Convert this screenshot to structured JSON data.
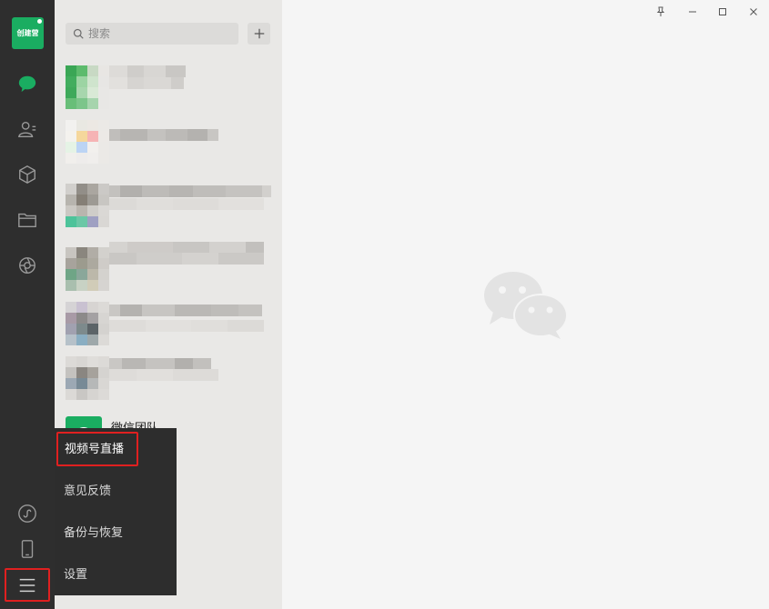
{
  "app": {
    "avatar_text": "创建营"
  },
  "search": {
    "placeholder": "搜索"
  },
  "chat_list": {
    "team_name": "微信团队"
  },
  "popup_menu": {
    "items": [
      "视频号直播",
      "意见反馈",
      "备份与恢复",
      "设置"
    ],
    "highlighted": "视频号直播"
  },
  "colors": {
    "brand_green": "#1aad61",
    "nav_bg": "#2e2e2e",
    "highlight_red": "#e02020"
  },
  "icons": {
    "nav": [
      "chat-icon",
      "contacts-icon",
      "favorites-icon",
      "files-icon",
      "moments-icon"
    ],
    "bottom": [
      "mini-program-icon",
      "phone-icon",
      "menu-icon"
    ],
    "window": [
      "pin-icon",
      "minimize-icon",
      "maximize-icon",
      "close-icon"
    ]
  }
}
